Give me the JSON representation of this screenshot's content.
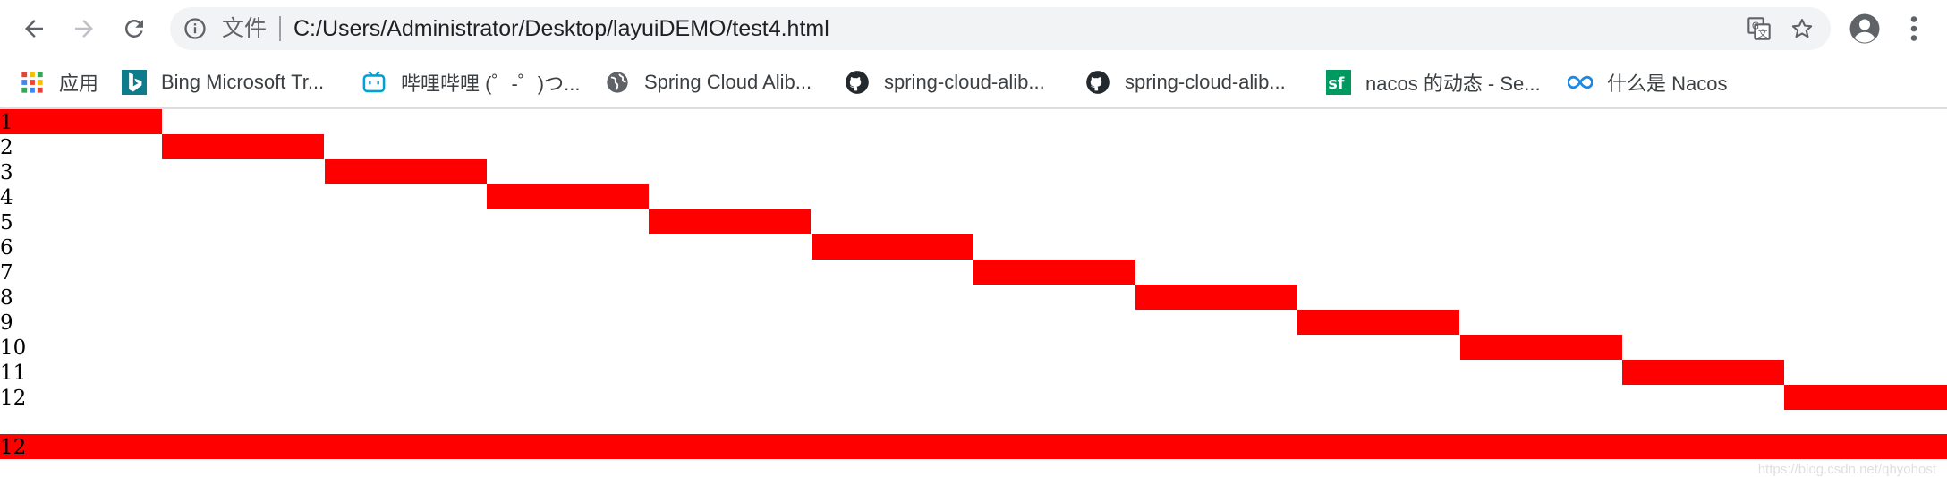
{
  "toolbar": {
    "scheme_label": "文件",
    "url": "C:/Users/Administrator/Desktop/layuiDEMO/test4.html"
  },
  "bookmarks": [
    {
      "label": "应用",
      "icon": "apps-grid-icon"
    },
    {
      "label": "Bing Microsoft Tr...",
      "icon": "bing-icon"
    },
    {
      "label": "哔哩哔哩 (゜-゜)つ...",
      "icon": "bilibili-icon"
    },
    {
      "label": "Spring Cloud Alib...",
      "icon": "globe-icon"
    },
    {
      "label": "spring-cloud-alib...",
      "icon": "github-icon"
    },
    {
      "label": "spring-cloud-alib...",
      "icon": "github-icon"
    },
    {
      "label": "nacos 的动态 - Se...",
      "icon": "segmentfault-icon"
    },
    {
      "label": "什么是 Nacos",
      "icon": "nacos-icon"
    }
  ],
  "page": {
    "rows": [
      {
        "label": "1"
      },
      {
        "label": "2"
      },
      {
        "label": "3"
      },
      {
        "label": "4"
      },
      {
        "label": "5"
      },
      {
        "label": "6"
      },
      {
        "label": "7"
      },
      {
        "label": "8"
      },
      {
        "label": "9"
      },
      {
        "label": "10"
      },
      {
        "label": "11"
      },
      {
        "label": "12"
      }
    ],
    "bottom_row_label": "12",
    "bar_color": "#ff0000",
    "watermark": "https://blog.csdn.net/qhyohost"
  }
}
